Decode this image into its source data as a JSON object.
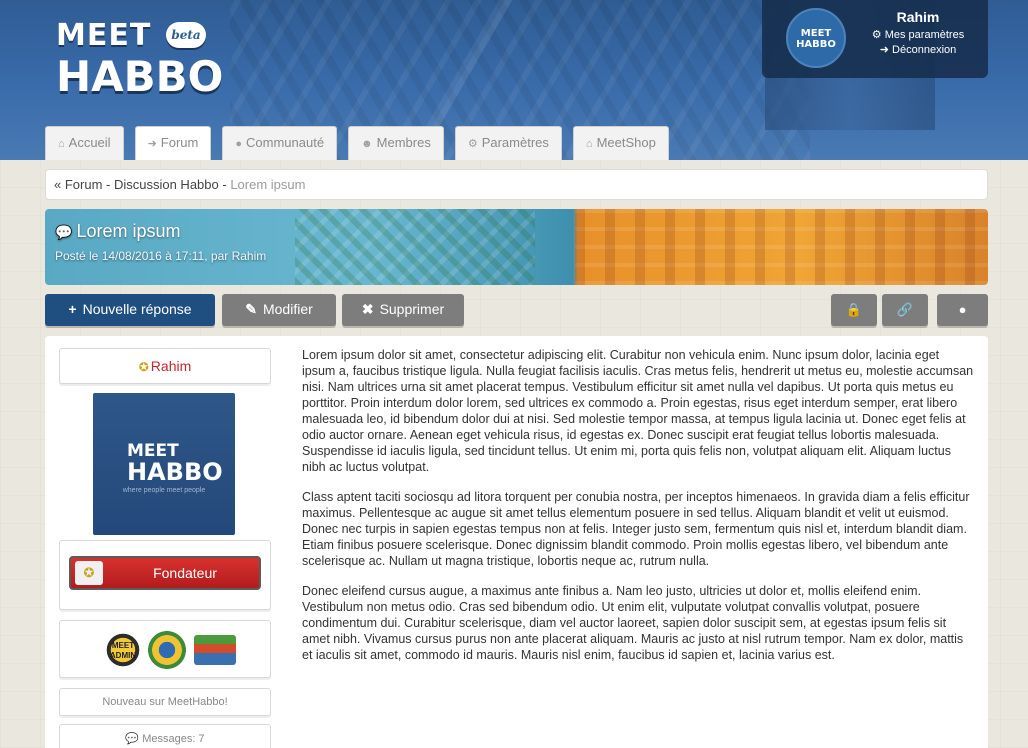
{
  "brand": {
    "line1": "MEET",
    "line2": "HABBO",
    "badge": "beta"
  },
  "user": {
    "name": "Rahim",
    "avatar_text": "MEET HABBO",
    "settings_icon": "gear-icon",
    "settings_label": "Mes paramètres",
    "logout_icon": "logout-icon",
    "logout_label": "Déconnexion"
  },
  "nav": {
    "tabs": [
      {
        "icon": "home-icon",
        "label": "Accueil"
      },
      {
        "icon": "signin-icon",
        "label": "Forum"
      },
      {
        "icon": "globe-icon",
        "label": "Communauté"
      },
      {
        "icon": "users-icon",
        "label": "Membres"
      },
      {
        "icon": "gear-icon",
        "label": "Paramètres"
      },
      {
        "icon": "shop-icon",
        "label": "MeetShop"
      }
    ],
    "active": "Forum"
  },
  "breadcrumb": {
    "prefix": "« ",
    "forum": "Forum",
    "sep1": " - ",
    "category": "Discussion Habbo",
    "sep2": " - ",
    "current": "Lorem ipsum"
  },
  "topic": {
    "title": "Lorem ipsum",
    "posted": "Posté le 14/08/2016 à 17:11, par Rahim"
  },
  "actions": {
    "new_reply": "Nouvelle réponse",
    "edit": "Modifier",
    "delete": "Supprimer",
    "lock_icon": "lock-icon",
    "link_icon": "link-icon",
    "globe_icon": "globe-icon"
  },
  "author": {
    "name": "Rahim",
    "avatar_line1": "MEET",
    "avatar_line2": "HABBO",
    "avatar_tagline": "where people meet people",
    "rank": "Fondateur",
    "badges": [
      {
        "name": "meet-admin-badge",
        "text": "MEET ADMIN"
      },
      {
        "name": "sheriff-badge",
        "text": ""
      },
      {
        "name": "stack-badge",
        "text": ""
      }
    ],
    "status": "Nouveau sur MeetHabbo!",
    "messages": "Messages: 7"
  },
  "post": {
    "paragraphs": [
      "Lorem ipsum dolor sit amet, consectetur adipiscing elit. Curabitur non vehicula enim. Nunc ipsum dolor, lacinia eget ipsum a, faucibus tristique ligula. Nulla feugiat facilisis iaculis. Cras metus felis, hendrerit ut metus eu, molestie accumsan nisi. Nam ultrices urna sit amet placerat tempus. Vestibulum efficitur sit amet nulla vel dapibus. Ut porta quis metus eu porttitor. Proin interdum dolor lorem, sed ultrices ex commodo a. Proin egestas, risus eget interdum semper, erat libero malesuada leo, id bibendum dolor dui at nisi. Sed molestie tempor massa, at tempus ligula lacinia ut. Donec eget felis at odio auctor ornare. Aenean eget vehicula risus, id egestas ex. Donec suscipit erat feugiat tellus lobortis malesuada. Suspendisse id iaculis ligula, sed tincidunt tellus. Ut enim mi, porta quis felis non, volutpat aliquam elit. Aliquam luctus nibh ac luctus volutpat.",
      "Class aptent taciti sociosqu ad litora torquent per conubia nostra, per inceptos himenaeos. In gravida diam a felis efficitur maximus. Pellentesque ac augue sit amet tellus elementum posuere in sed tellus. Aliquam blandit et velit ut euismod. Donec nec turpis in sapien egestas tempus non at felis. Integer justo sem, fermentum quis nisl et, interdum blandit diam. Etiam finibus posuere scelerisque. Donec dignissim blandit commodo. Proin mollis egestas libero, vel bibendum ante scelerisque ac. Nullam ut magna tristique, lobortis neque ac, rutrum nulla.",
      "Donec eleifend cursus augue, a maximus ante finibus a. Nam leo justo, ultricies ut dolor et, mollis eleifend enim. Vestibulum non metus odio. Cras sed bibendum odio. Ut enim elit, vulputate volutpat convallis volutpat, posuere condimentum dui. Curabitur scelerisque, diam vel auctor laoreet, sapien dolor suscipit sem, at egestas ipsum felis sit amet nibh. Vivamus cursus purus non ante placerat aliquam. Mauris ac justo at nisl rutrum tempor. Nam ex dolor, mattis et iaculis sit amet, commodo id mauris. Mauris nisl enim, faucibus id sapien et, lacinia varius est."
    ]
  },
  "colors": {
    "header_blue": "#2f5c93",
    "primary_button": "#1f4f80",
    "grey_button": "#7d7d7d",
    "rank_red": "#c4262c"
  }
}
